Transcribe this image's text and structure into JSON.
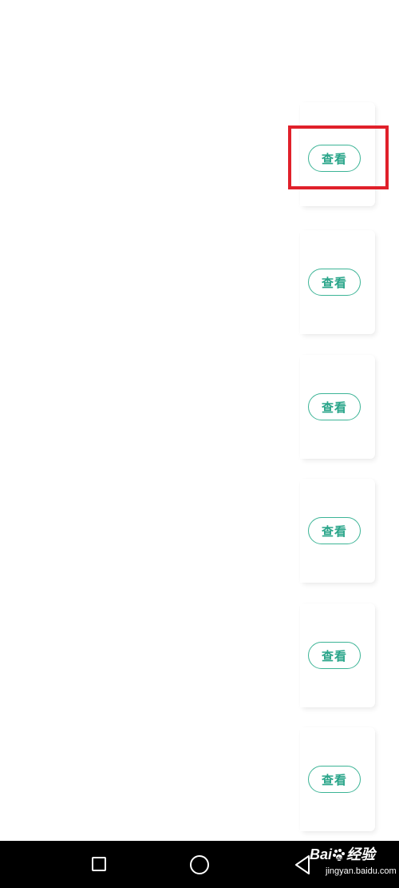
{
  "list": {
    "items": [
      {
        "action_label": "查看",
        "highlighted": true
      },
      {
        "action_label": "查看",
        "highlighted": false
      },
      {
        "action_label": "查看",
        "highlighted": false
      },
      {
        "action_label": "查看",
        "highlighted": false
      },
      {
        "action_label": "查看",
        "highlighted": false
      },
      {
        "action_label": "查看",
        "highlighted": false
      }
    ]
  },
  "colors": {
    "accent": "#2aa58a",
    "button_border": "#3cb496",
    "highlight": "#e0202a",
    "navbar": "#000000"
  },
  "navbar": {
    "recent_icon": "square-icon",
    "home_icon": "circle-icon",
    "back_icon": "triangle-back-icon"
  },
  "watermark": {
    "brand_prefix": "Bai",
    "brand_suffix": "经验",
    "domain": "jingyan.baidu.com"
  }
}
